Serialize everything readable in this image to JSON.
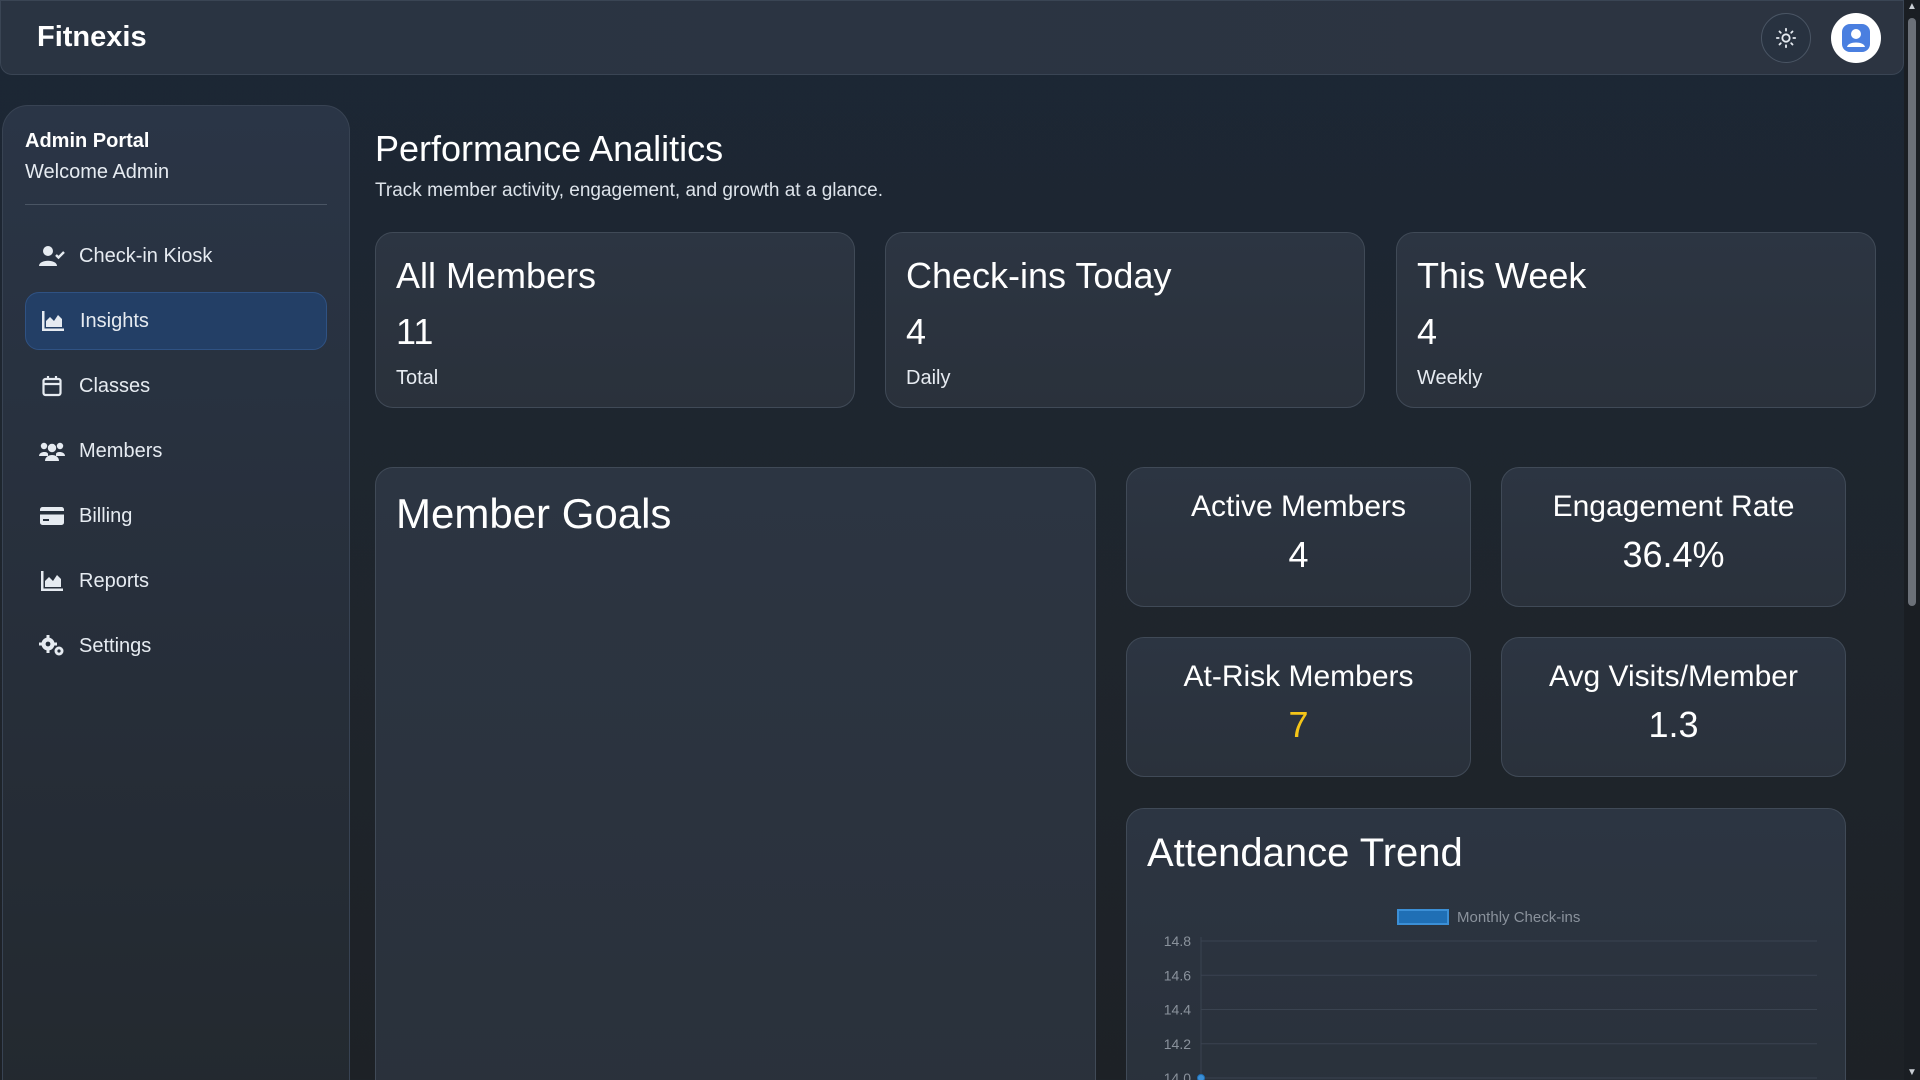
{
  "app": {
    "brand": "Fitnexis"
  },
  "sidebar": {
    "portal_title": "Admin Portal",
    "welcome": "Welcome Admin",
    "items": [
      {
        "label": "Check-in Kiosk",
        "icon": "user-check-icon"
      },
      {
        "label": "Insights",
        "icon": "chart-area-icon",
        "active": true
      },
      {
        "label": "Classes",
        "icon": "calendar-icon"
      },
      {
        "label": "Members",
        "icon": "users-icon"
      },
      {
        "label": "Billing",
        "icon": "credit-card-icon"
      },
      {
        "label": "Reports",
        "icon": "chart-area-icon"
      },
      {
        "label": "Settings",
        "icon": "gears-icon"
      }
    ]
  },
  "header": {
    "title": "Performance Analitics",
    "subtitle": "Track member activity, engagement, and growth at a glance."
  },
  "stats": [
    {
      "title": "All Members",
      "value": "11",
      "label": "Total"
    },
    {
      "title": "Check-ins Today",
      "value": "4",
      "label": "Daily"
    },
    {
      "title": "This Week",
      "value": "4",
      "label": "Weekly"
    }
  ],
  "goals": {
    "title": "Member Goals"
  },
  "metrics": [
    {
      "title": "Active Members",
      "value": "4"
    },
    {
      "title": "Engagement Rate",
      "value": "36.4%"
    },
    {
      "title": "At-Risk Members",
      "value": "7",
      "highlight": true
    },
    {
      "title": "Avg Visits/Member",
      "value": "1.3"
    }
  ],
  "trend": {
    "title": "Attendance Trend"
  },
  "colors": {
    "accent": "#3b8fd6",
    "warning": "#f5c518",
    "active_nav": "#233f66"
  },
  "chart_data": {
    "type": "line",
    "title": "",
    "legend": [
      "Monthly Check-ins"
    ],
    "legend_position": "top-center",
    "series": [
      {
        "name": "Monthly Check-ins",
        "values": [
          14.0
        ]
      }
    ],
    "y_ticks": [
      "14.8",
      "14.6",
      "14.4",
      "14.2",
      "14.0"
    ],
    "ylim": [
      14.0,
      14.8
    ],
    "grid": true
  }
}
